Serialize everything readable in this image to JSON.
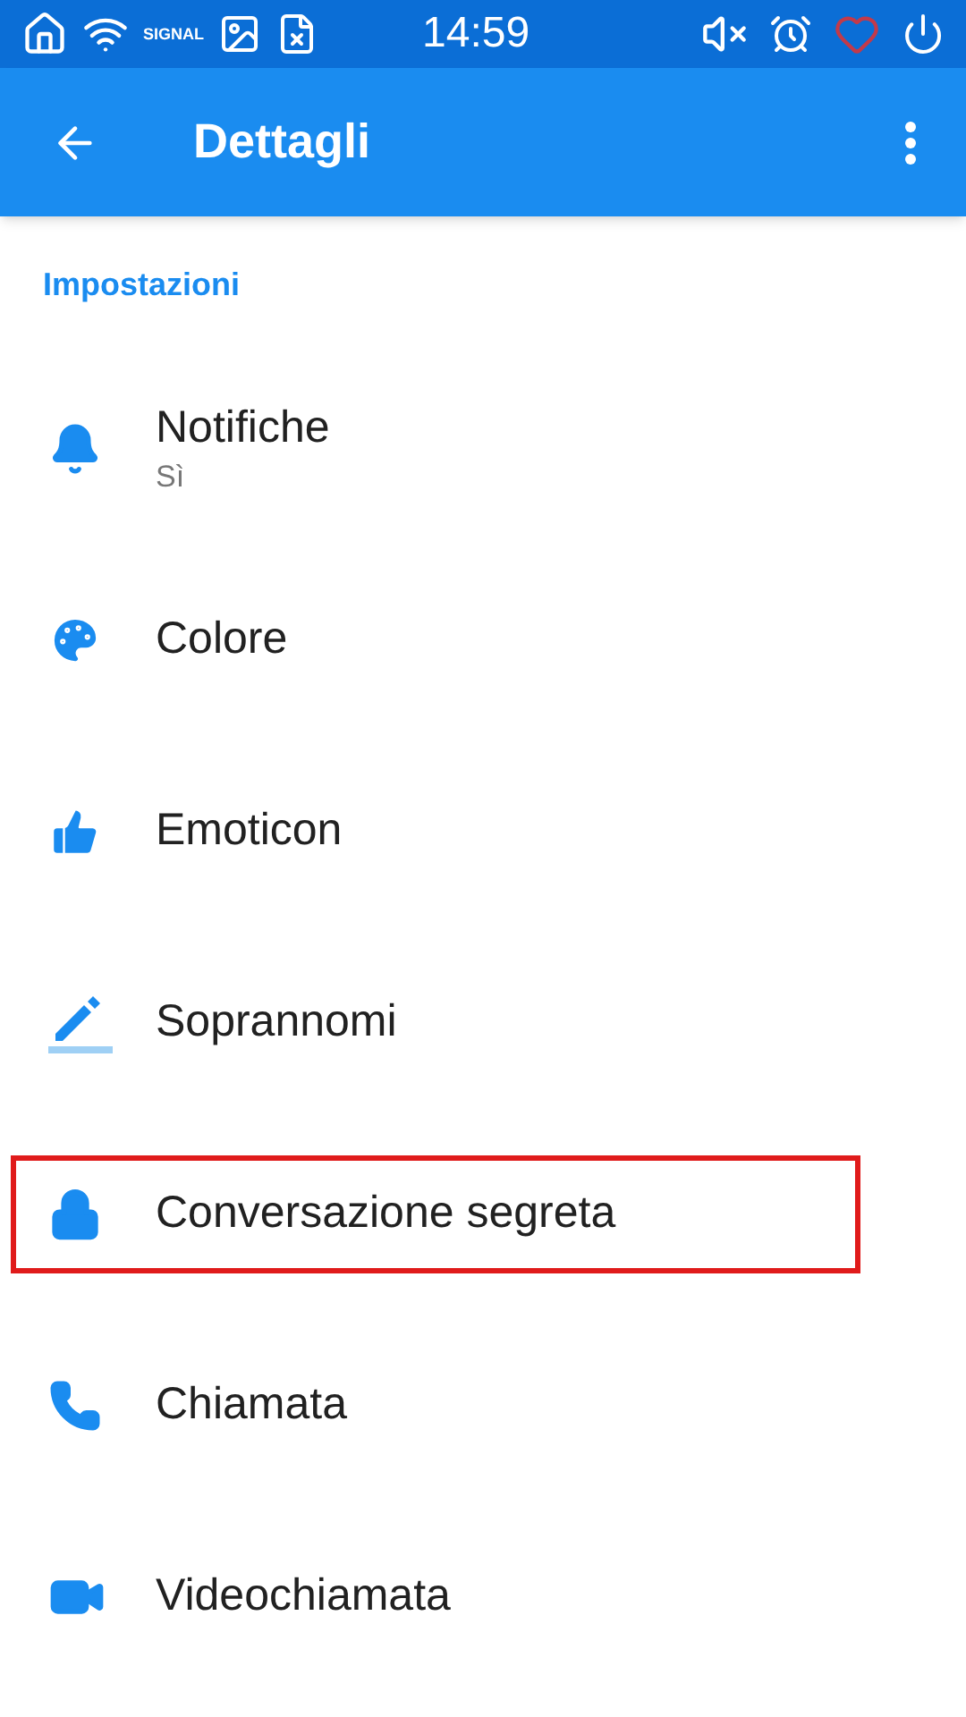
{
  "status_bar": {
    "signal_label": "SIGNAL",
    "time": "14:59"
  },
  "app_bar": {
    "title": "Dettagli"
  },
  "section": {
    "title": "Impostazioni"
  },
  "items": [
    {
      "kind": "bell",
      "label": "Notifiche",
      "subtitle": "Sì",
      "highlighted": false
    },
    {
      "kind": "palette",
      "label": "Colore",
      "highlighted": false
    },
    {
      "kind": "thumb",
      "label": "Emoticon",
      "highlighted": false
    },
    {
      "kind": "pencil",
      "label": "Soprannomi",
      "highlighted": false
    },
    {
      "kind": "lock",
      "label": "Conversazione segreta",
      "highlighted": true
    },
    {
      "kind": "phone",
      "label": "Chiamata",
      "highlighted": false
    },
    {
      "kind": "video",
      "label": "Videochiamata",
      "highlighted": false
    }
  ]
}
